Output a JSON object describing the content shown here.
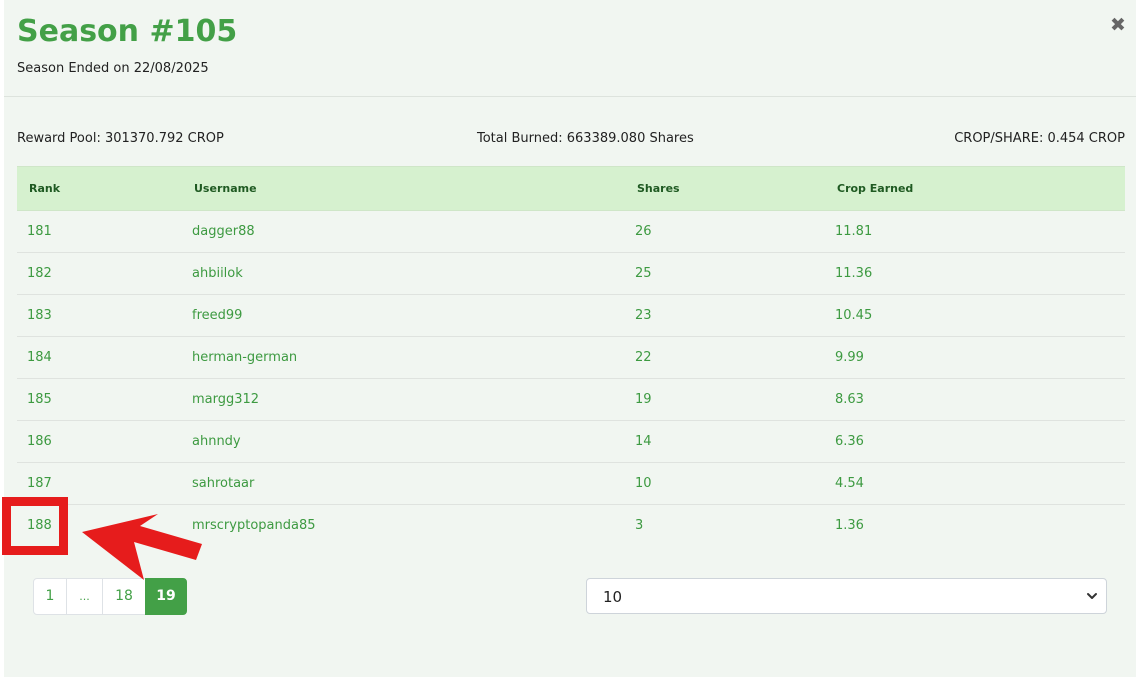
{
  "modal": {
    "title": "Season #105",
    "subtitle": "Season Ended on 22/08/2025",
    "close_glyph": "✖"
  },
  "stats": {
    "reward_pool": "Reward Pool: 301370.792 CROP",
    "total_burned": "Total Burned: 663389.080 Shares",
    "crop_per_share": "CROP/SHARE: 0.454 CROP"
  },
  "table": {
    "headers": [
      "Rank",
      "Username",
      "Shares",
      "Crop Earned"
    ],
    "rows": [
      {
        "rank": "181",
        "username": "dagger88",
        "shares": "26",
        "crop": "11.81"
      },
      {
        "rank": "182",
        "username": "ahbiilok",
        "shares": "25",
        "crop": "11.36"
      },
      {
        "rank": "183",
        "username": "freed99",
        "shares": "23",
        "crop": "10.45"
      },
      {
        "rank": "184",
        "username": "herman-german",
        "shares": "22",
        "crop": "9.99"
      },
      {
        "rank": "185",
        "username": "margg312",
        "shares": "19",
        "crop": "8.63"
      },
      {
        "rank": "186",
        "username": "ahnndy",
        "shares": "14",
        "crop": "6.36"
      },
      {
        "rank": "187",
        "username": "sahrotaar",
        "shares": "10",
        "crop": "4.54"
      },
      {
        "rank": "188",
        "username": "mrscryptopanda85",
        "shares": "3",
        "crop": "1.36"
      }
    ]
  },
  "pagination": {
    "pages": [
      "1",
      "...",
      "18",
      "19"
    ],
    "active": "19"
  },
  "page_size": {
    "selected": "10"
  },
  "colors": {
    "accent": "#43a047",
    "header_bg": "#d6f1cf",
    "annotation": "#e61c1c"
  },
  "icons": {
    "close": "close-icon",
    "select": "chevron-down-icon",
    "annotation": "arrow-icon"
  }
}
